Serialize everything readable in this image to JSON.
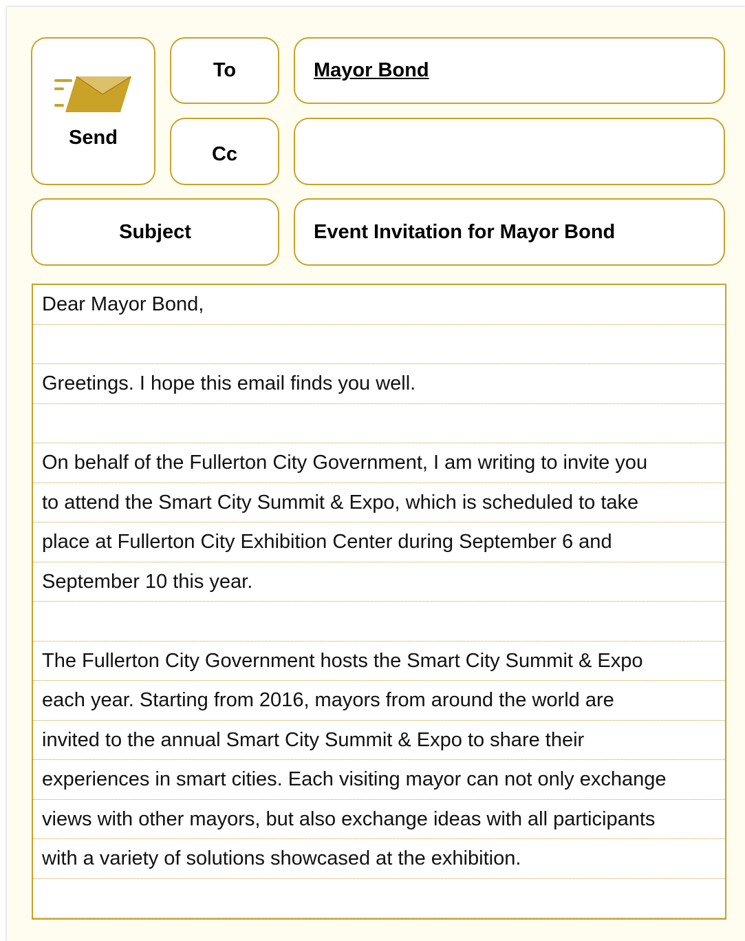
{
  "header": {
    "send_label": "Send",
    "send_icon": "send-envelope-icon",
    "to_label": "To",
    "to_value": "Mayor Bond",
    "cc_label": "Cc",
    "cc_value": "",
    "subject_label": "Subject",
    "subject_value": "Event Invitation for Mayor Bond"
  },
  "colors": {
    "accent": "#c9a227",
    "background": "#fffdf0"
  },
  "body": {
    "lines": [
      "Dear Mayor Bond,",
      "",
      "Greetings. I hope this email finds you well.",
      "",
      "On behalf of the Fullerton City Government, I am writing to invite you",
      "to attend the Smart City Summit & Expo, which is scheduled to take",
      "place at Fullerton City Exhibition Center during September 6 and",
      "September 10 this year.",
      "",
      "The Fullerton City Government hosts the Smart City Summit & Expo",
      "each year. Starting from 2016, mayors from around the world are",
      "invited to the annual Smart City Summit & Expo to share their",
      "experiences in smart cities. Each visiting mayor can not only exchange",
      "views with other mayors, but also exchange ideas with all participants",
      "with a variety of solutions showcased at the exhibition.",
      ""
    ]
  }
}
